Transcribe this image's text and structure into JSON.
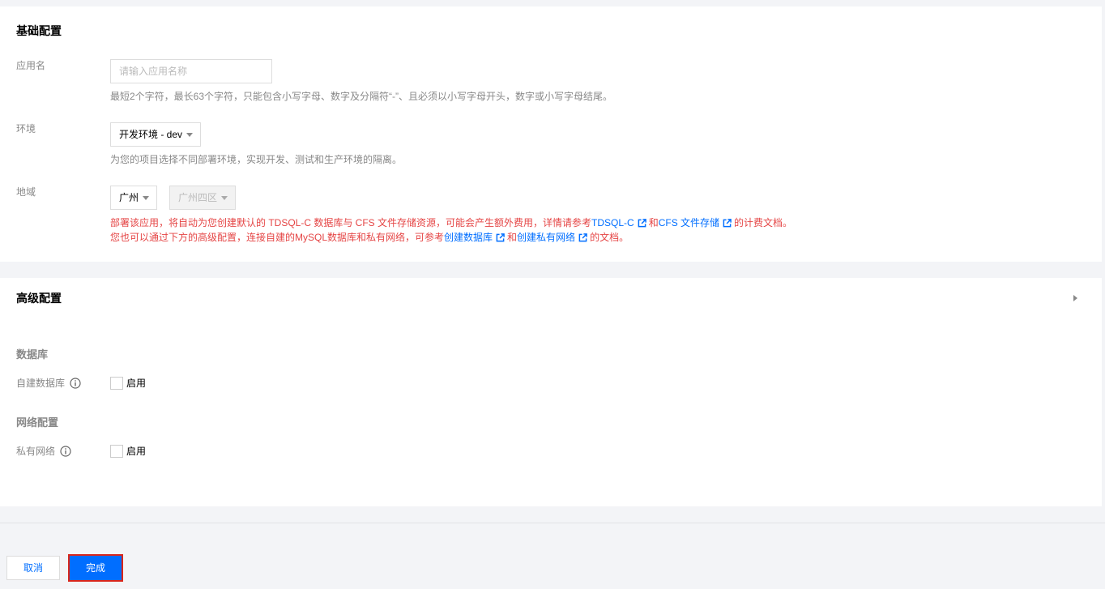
{
  "colors": {
    "page_bg": "#f3f4f7",
    "panel_bg": "#ffffff",
    "text": "#000000",
    "label": "#888888",
    "notice": "#e54545",
    "link": "#006eff",
    "primary": "#006eff",
    "highlight": "#d9261c"
  },
  "icons": {
    "external_link": "external-link-icon",
    "info": "info-icon",
    "dropdown": "chevron-down-icon",
    "expand": "caret-right-icon"
  },
  "basic": {
    "title": "基础配置",
    "app_name": {
      "label": "应用名",
      "placeholder": "请输入应用名称",
      "hint": "最短2个字符，最长63个字符，只能包含小写字母、数字及分隔符“-”、且必须以小写字母开头，数字或小写字母结尾。"
    },
    "env": {
      "label": "环境",
      "value": "开发环境 - dev",
      "hint": "为您的项目选择不同部署环境，实现开发、测试和生产环境的隔离。"
    },
    "region": {
      "label": "地域",
      "value": "广州",
      "zone": "广州四区",
      "zone_disabled": true,
      "notice": {
        "line1": {
          "text": "部署该应用，将自动为您创建默认的 TDSQL-C 数据库与 CFS 文件存储资源，可能会产生额外费用，详情请参考",
          "link1": "TDSQL-C",
          "sep": "和",
          "link2": "CFS 文件存储",
          "tail": "的计费文档。"
        },
        "line2": {
          "text": "您也可以通过下方的高级配置，连接自建的MySQL数据库和私有网络，可参考",
          "link1": "创建数据库",
          "sep": "和",
          "link2": "创建私有网络",
          "tail": "的文档。"
        }
      }
    }
  },
  "advanced": {
    "title": "高级配置",
    "database": {
      "heading": "数据库",
      "label": "自建数据库",
      "checkbox_label": "启用",
      "checked": false
    },
    "network": {
      "heading": "网络配置",
      "label": "私有网络",
      "checkbox_label": "启用",
      "checked": false
    }
  },
  "footer": {
    "cancel": "取消",
    "confirm": "完成"
  }
}
